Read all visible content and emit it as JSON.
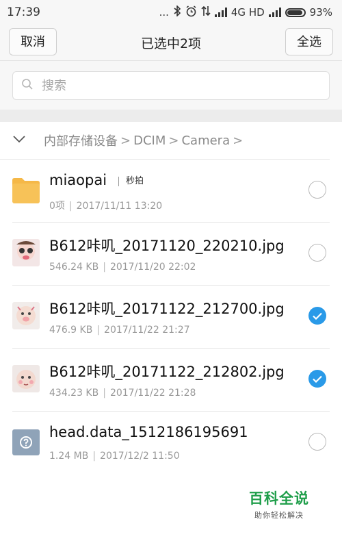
{
  "status_bar": {
    "time": "17:39",
    "dots": "...",
    "network": "4G HD",
    "battery_percent": "93%",
    "battery_level": 0.93,
    "icons": [
      "bluetooth-icon",
      "alarm-icon",
      "data-arrows-icon",
      "signal-icon",
      "signal-icon",
      "battery-icon"
    ]
  },
  "action_bar": {
    "cancel_label": "取消",
    "title": "已选中2项",
    "select_all_label": "全选"
  },
  "search": {
    "placeholder": "搜索"
  },
  "breadcrumb": {
    "items": [
      "内部存储设备",
      "DCIM",
      "Camera"
    ],
    "separator": ">"
  },
  "files": [
    {
      "name": "miaopai",
      "tag": "秒拍",
      "meta_left": "0项",
      "meta_right": "2017/11/11 13:20",
      "type": "folder",
      "selected": false
    },
    {
      "name": "B612咔叽_20171120_220210.jpg",
      "meta_left": "546.24 KB",
      "meta_right": "2017/11/20 22:02",
      "type": "image",
      "selected": false
    },
    {
      "name": "B612咔叽_20171122_212700.jpg",
      "meta_left": "476.9 KB",
      "meta_right": "2017/11/22 21:27",
      "type": "image",
      "selected": true
    },
    {
      "name": "B612咔叽_20171122_212802.jpg",
      "meta_left": "434.23 KB",
      "meta_right": "2017/11/22 21:28",
      "type": "image",
      "selected": true
    },
    {
      "name": "head.data_1512186195691",
      "meta_left": "1.24 MB",
      "meta_right": "2017/12/2 11:50",
      "type": "unknown",
      "selected": false
    }
  ],
  "watermark": {
    "title": "百科全说",
    "subtitle": "助你轻松解决"
  },
  "colors": {
    "accent": "#2a9ae8",
    "folder": "#f5b848",
    "watermark_green": "#1f9e4a"
  }
}
